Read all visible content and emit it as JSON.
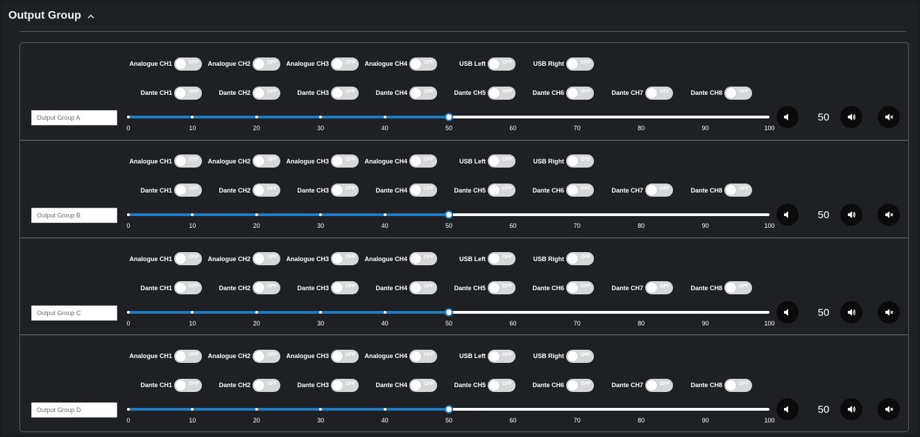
{
  "header": {
    "title": "Output Group"
  },
  "analogue_labels": [
    "Analogue CH1",
    "Analogue CH2",
    "Analogue CH3",
    "Analogue CH4",
    "USB Left",
    "USB Right"
  ],
  "dante_labels": [
    "Dante CH1",
    "Dante CH2",
    "Dante CH3",
    "Dante CH4",
    "Dante CH5",
    "Dante CH6",
    "Dante CH7",
    "Dante CH8"
  ],
  "toggle_state_text": "OFF",
  "slider": {
    "min": 0,
    "max": 100,
    "ticks": [
      "0",
      "10",
      "20",
      "30",
      "40",
      "50",
      "60",
      "70",
      "80",
      "90",
      "100"
    ]
  },
  "colors": {
    "accent": "#1f7cc1",
    "background": "#1f2023",
    "button": "#0b0b0c"
  },
  "groups": [
    {
      "name": "Output Group A",
      "volume": 50,
      "volume_label": "50"
    },
    {
      "name": "Output Group B",
      "volume": 50,
      "volume_label": "50"
    },
    {
      "name": "Output Group C",
      "volume": 50,
      "volume_label": "50"
    },
    {
      "name": "Output Group D",
      "volume": 50,
      "volume_label": "50"
    }
  ],
  "icons": {
    "collapse": "chevron-up-icon",
    "volume_down": "volume-down-icon",
    "volume_up": "volume-up-icon",
    "mute": "mute-icon"
  }
}
